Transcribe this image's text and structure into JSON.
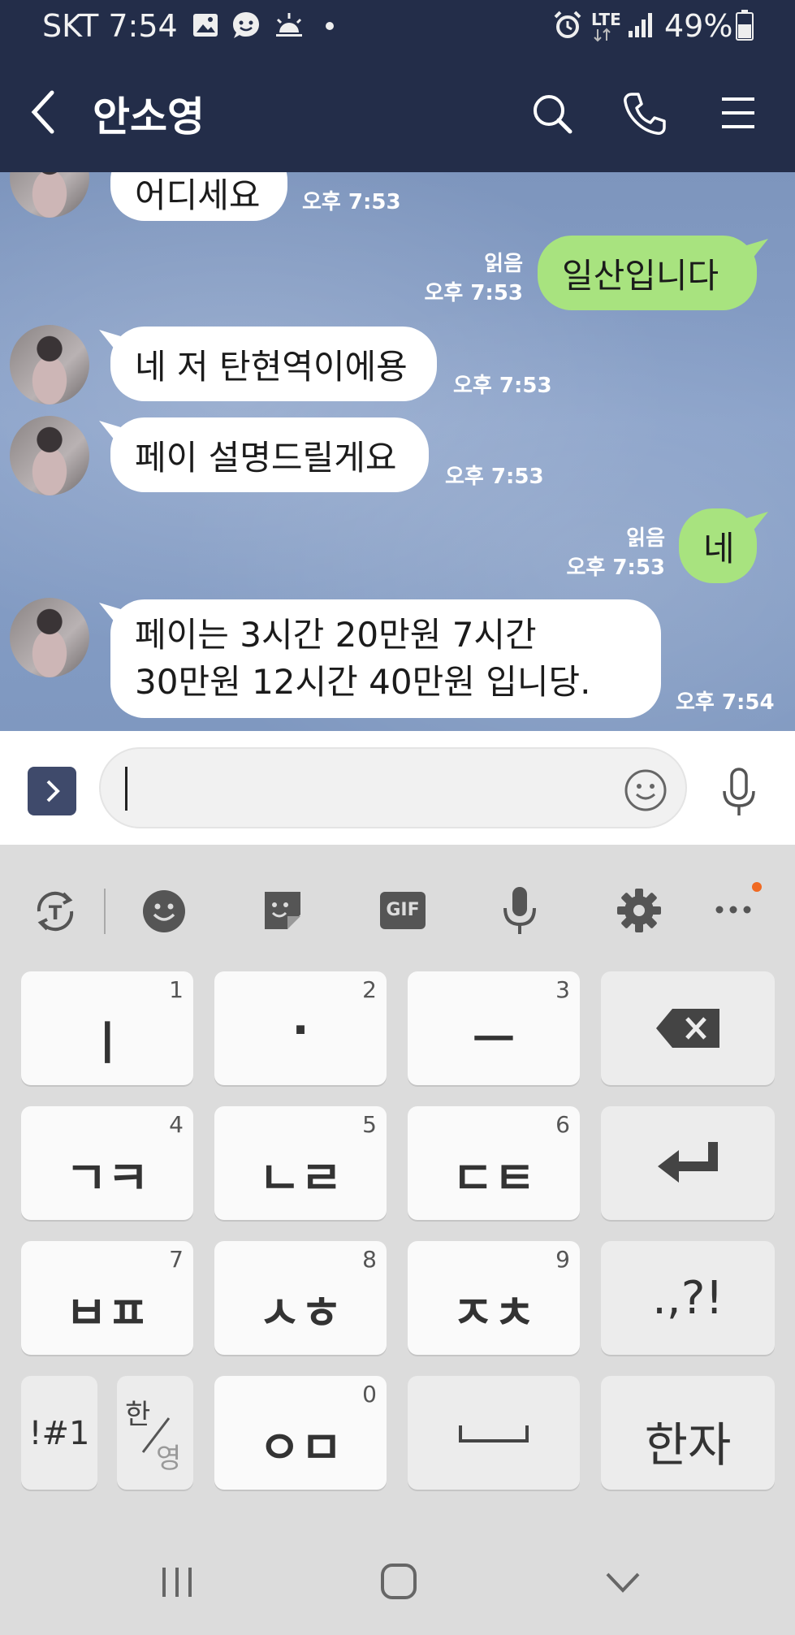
{
  "status": {
    "carrier_time": "SKT 7:54",
    "network": "LTE",
    "battery": "49%"
  },
  "header": {
    "contact_name": "안소영"
  },
  "messages": {
    "m1": {
      "text": "어디세요",
      "time": "오후 7:53"
    },
    "m2": {
      "text": "일산입니다",
      "read": "읽음",
      "time": "오후 7:53"
    },
    "m3": {
      "text": "네 저 탄현역이에용",
      "time": "오후 7:53"
    },
    "m4": {
      "text": "페이 설명드릴게요",
      "time": "오후 7:53"
    },
    "m5": {
      "text": "네",
      "read": "읽음",
      "time": "오후 7:53"
    },
    "m6": {
      "line1": "페이는 3시간 20만원 7시간",
      "line2": "30만원 12시간 40만원 입니당.",
      "time": "오후 7:54"
    }
  },
  "input": {
    "value": "",
    "placeholder": ""
  },
  "keyboard": {
    "toolbar": {
      "gif": "GIF"
    },
    "keys": {
      "k1": {
        "label": "ㅣ",
        "num": "1"
      },
      "k2": {
        "label": "·",
        "num": "2"
      },
      "k3": {
        "label": "ㅡ",
        "num": "3"
      },
      "k4": {
        "label": "ㄱㅋ",
        "num": "4"
      },
      "k5": {
        "label": "ㄴㄹ",
        "num": "5"
      },
      "k6": {
        "label": "ㄷㅌ",
        "num": "6"
      },
      "k7": {
        "label": "ㅂㅍ",
        "num": "7"
      },
      "k8": {
        "label": "ㅅㅎ",
        "num": "8"
      },
      "k9": {
        "label": "ㅈㅊ",
        "num": "9"
      },
      "k0": {
        "label": "ㅇㅁ",
        "num": "0"
      },
      "punct": {
        "label": ".,?!"
      },
      "symbols": {
        "label": "!#1"
      },
      "lang_top": "한",
      "lang_bottom": "영",
      "hanja": {
        "label": "한자"
      }
    }
  },
  "colors": {
    "header_bg": "#232d49",
    "chat_bg": "#839bc3",
    "outgoing_bubble": "#a8e37f",
    "incoming_bubble": "#ffffff",
    "keyboard_bg": "#dcdcdc"
  }
}
